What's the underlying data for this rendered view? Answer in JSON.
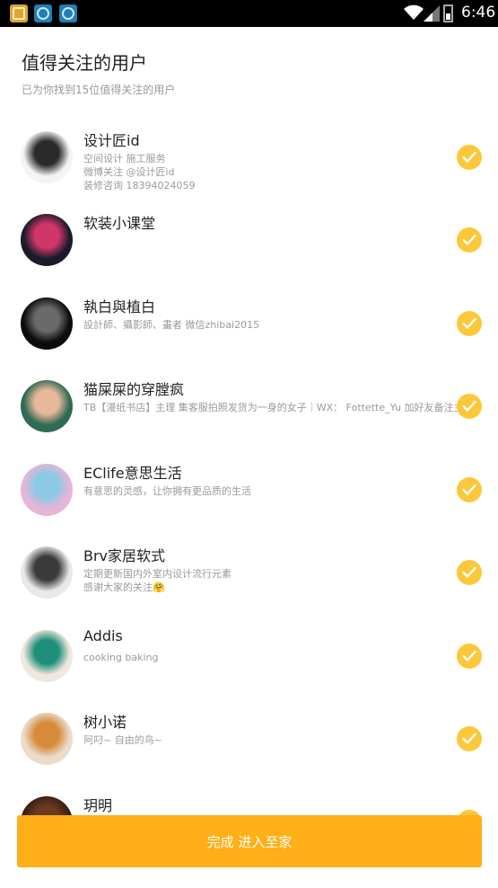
{
  "status_bar": {
    "time": "6:46"
  },
  "header": {
    "title": "值得关注的用户",
    "subtitle": "已为你找到15位值得关注的用户"
  },
  "users": [
    {
      "name": "设计匠id",
      "desc": [
        "空间设计 施工服务",
        "微博关注 @设计匠id",
        "装修咨询 18394024059"
      ],
      "checked": true,
      "avatar_colors": [
        "#f4f4f4",
        "#2a2a2a"
      ]
    },
    {
      "name": "软装小课堂",
      "desc": [],
      "checked": true,
      "avatar_colors": [
        "#1b1b2b",
        "#d1366b"
      ]
    },
    {
      "name": "執白與植白",
      "desc": [
        "設計師、攝影師、畫者 微信zhibai2015"
      ],
      "checked": true,
      "avatar_colors": [
        "#0c0c0c",
        "#6a6a6a"
      ]
    },
    {
      "name": "猫屎屎的穿膛疯",
      "desc": [
        "TB【漫纸书店】主理 集客服拍照发货为一身的女子｜WX： Fottette_Yu 加好友备注主家"
      ],
      "checked": true,
      "avatar_colors": [
        "#2f6a52",
        "#e7b89b"
      ]
    },
    {
      "name": "EClife意思生活",
      "desc": [
        "有意思的灵感，让你拥有更品质的生活"
      ],
      "checked": true,
      "avatar_colors": [
        "#e6b6d6",
        "#8bc9e6"
      ]
    },
    {
      "name": "Brv家居软式",
      "desc": [
        "定期更新国内外室内设计流行元素",
        "感谢大家的关注🤗"
      ],
      "checked": true,
      "avatar_colors": [
        "#e9e9e9",
        "#3a3a3a"
      ]
    },
    {
      "name": "Addis",
      "desc": [
        "cooking baking"
      ],
      "checked": true,
      "avatar_colors": [
        "#f0e7df",
        "#1e8f7a"
      ]
    },
    {
      "name": "树小诺",
      "desc": [
        "阿叼~ 自由的鸟~"
      ],
      "checked": true,
      "avatar_colors": [
        "#e9dccb",
        "#d78a3a"
      ]
    },
    {
      "name": "玥明",
      "desc": [],
      "checked": true,
      "avatar_colors": [
        "#3a1e12",
        "#6b3a22"
      ]
    }
  ],
  "done_button": {
    "label": "完成 进入至家"
  },
  "colors": {
    "accent": "#ffaf17",
    "check": "#fcc83a"
  }
}
